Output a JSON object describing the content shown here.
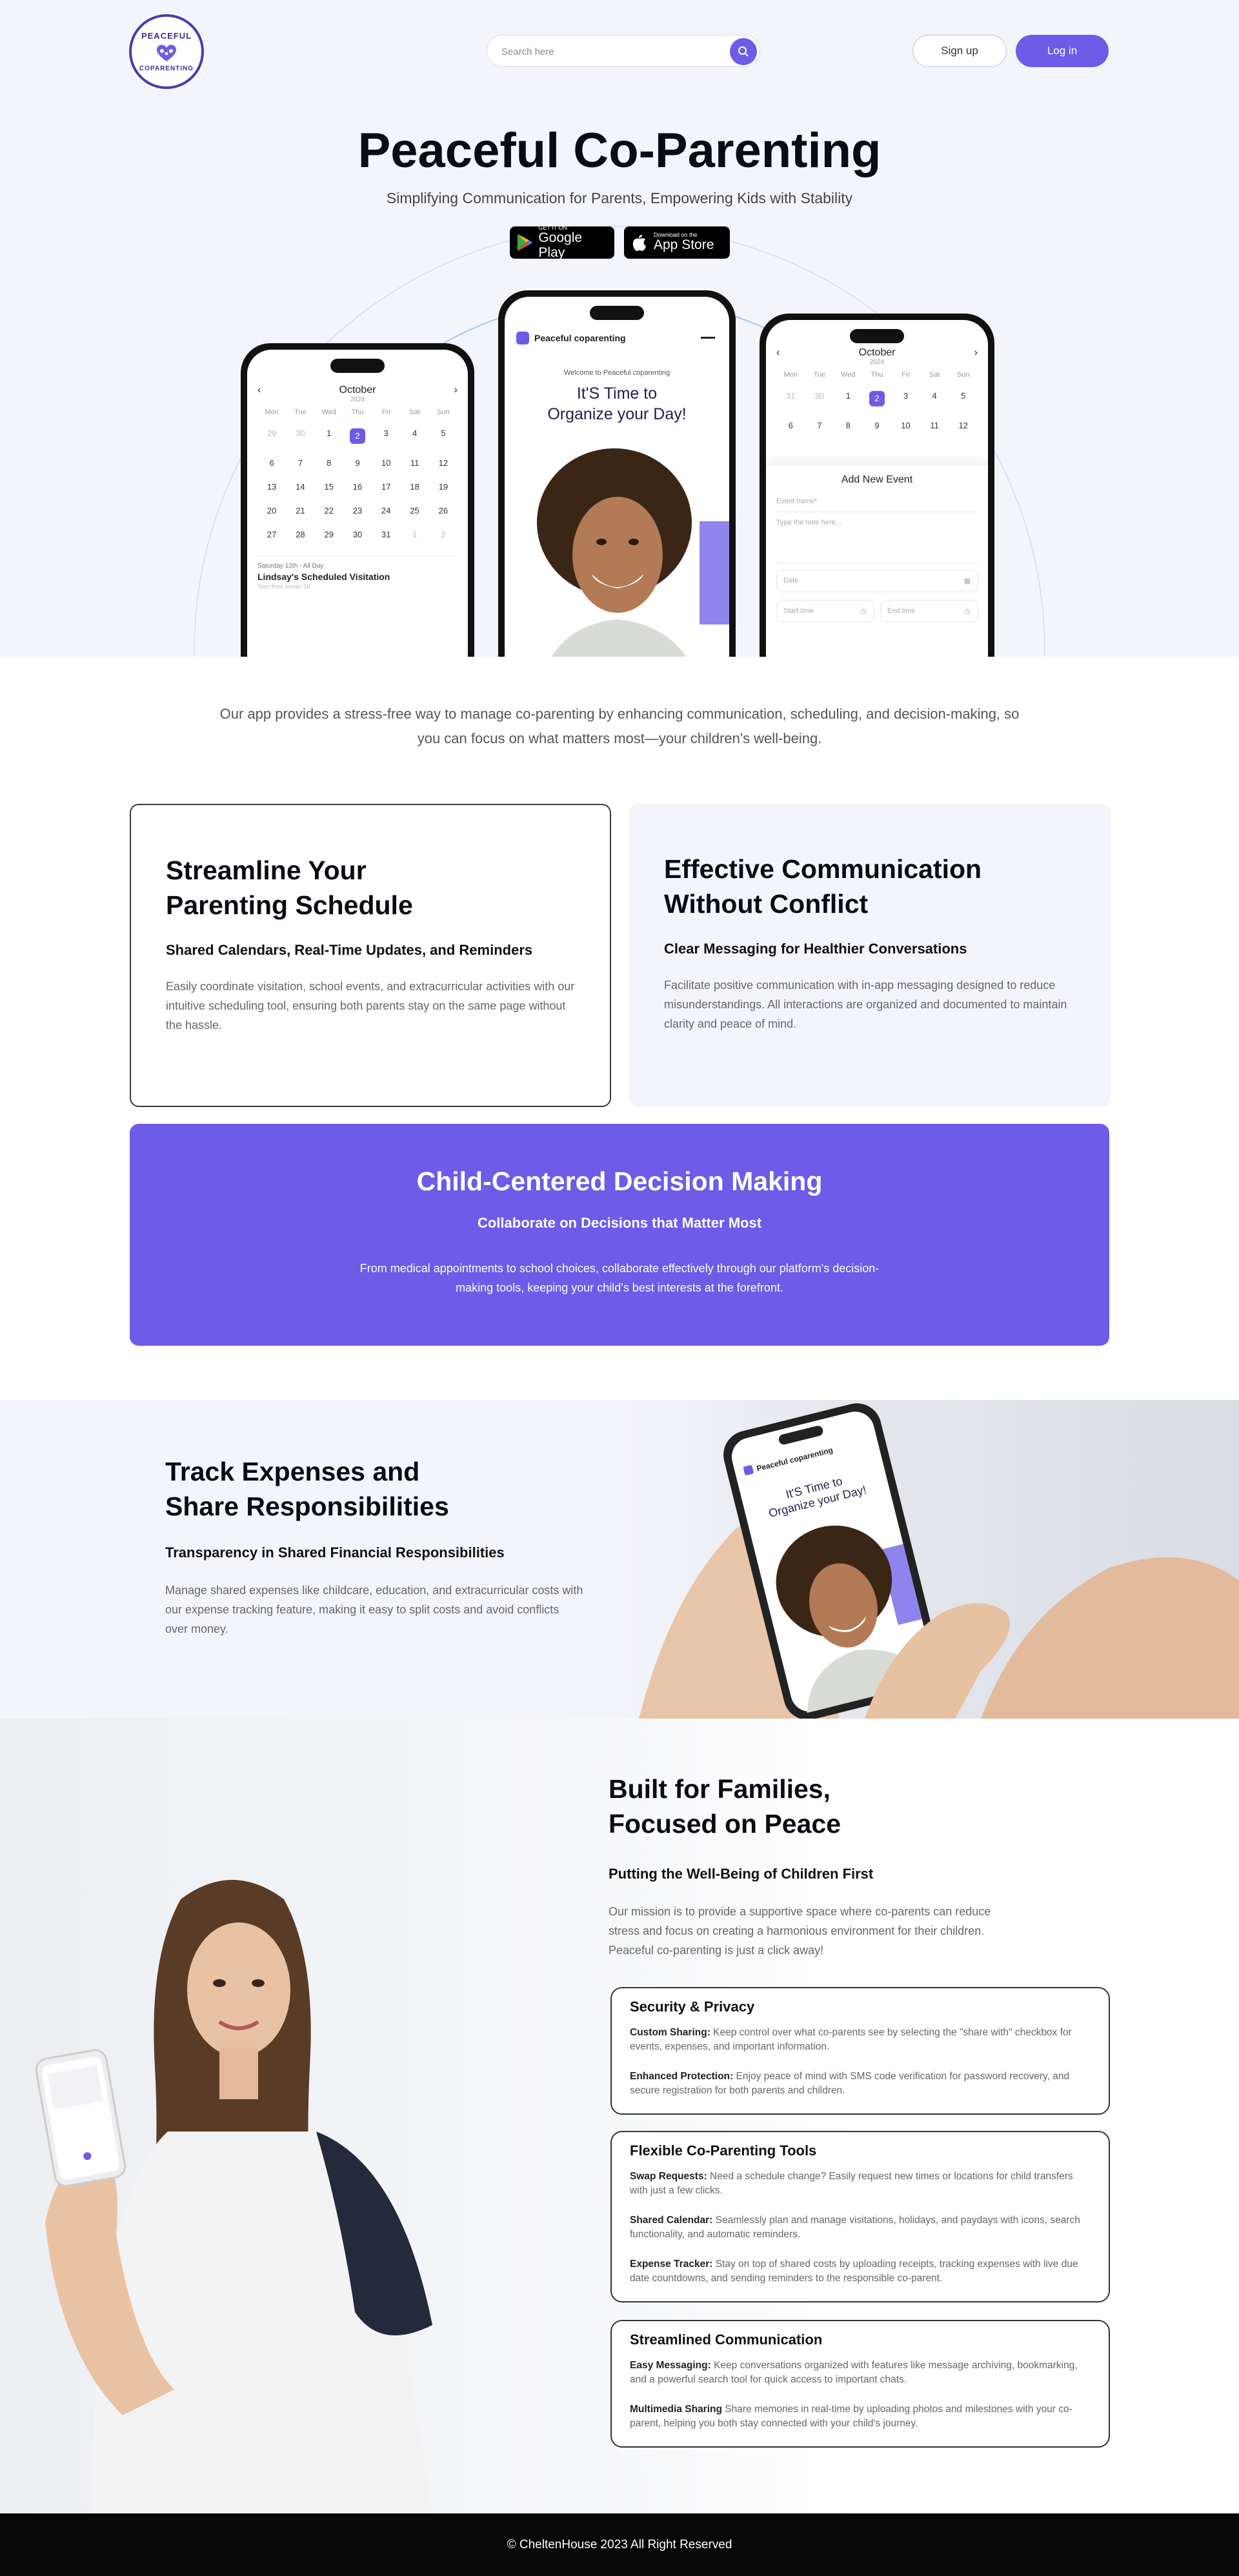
{
  "header": {
    "logo_top": "PEACEFUL",
    "logo_bottom": "COPARENTING",
    "search_placeholder": "Search here",
    "signup_label": "Sign up",
    "login_label": "Log in"
  },
  "hero": {
    "title": "Peaceful Co-Parenting",
    "subtitle": "Simplifying Communication for Parents, Empowering Kids with Stability",
    "google_small": "GET IT ON",
    "google_big": "Google Play",
    "apple_small": "Download on the",
    "apple_big": "App Store"
  },
  "phone_left": {
    "month": "October",
    "year": "2024",
    "dows": [
      "Mon",
      "Tue",
      "Wed",
      "Thu",
      "Fri",
      "Sat",
      "Sun"
    ],
    "rows": [
      [
        "29",
        "30",
        "1",
        "2",
        "3",
        "4",
        "5"
      ],
      [
        "6",
        "7",
        "8",
        "9",
        "10",
        "11",
        "12"
      ],
      [
        "13",
        "14",
        "15",
        "16",
        "17",
        "18",
        "19"
      ],
      [
        "20",
        "21",
        "22",
        "23",
        "24",
        "25",
        "26"
      ],
      [
        "27",
        "28",
        "29",
        "30",
        "31",
        "1",
        "2"
      ]
    ],
    "event_date": "Saturday 12th - All Day",
    "event_title": "Lindsay's Scheduled Visitation",
    "event_note": "Start from screen 1b"
  },
  "phone_center": {
    "brand": "Peaceful coparenting",
    "welcome": "Welcome to Peaceful coparenting",
    "headline_1": "It'S Time to",
    "headline_2": "Organize your Day!"
  },
  "phone_right": {
    "month": "October",
    "year": "2024",
    "dows": [
      "Mon",
      "Tue",
      "Wed",
      "Thu",
      "Fri",
      "Sat",
      "Sun"
    ],
    "rows": [
      [
        "31",
        "30",
        "1",
        "2",
        "3",
        "4",
        "5"
      ],
      [
        "6",
        "7",
        "8",
        "9",
        "10",
        "11",
        "12"
      ]
    ],
    "sheet_title": "Add New Event",
    "event_name": "Event name*",
    "note": "Type the note here...",
    "date": "Date",
    "start": "Start time",
    "end": "End time"
  },
  "intro": "Our app provides a stress-free way to manage co-parenting by enhancing communication, scheduling, and decision-making, so you can focus on what matters most—your children's well-being.",
  "card_schedule": {
    "title_1": "Streamline Your",
    "title_2": "Parenting Schedule",
    "subtitle": "Shared Calendars, Real-Time Updates, and Reminders",
    "body": "Easily coordinate visitation, school events, and extracurricular activities with our intuitive  scheduling tool, ensuring both parents stay on the same page without the hassle."
  },
  "card_comm": {
    "title_1": "Effective Communication",
    "title_2": "Without Conflict",
    "subtitle": "Clear Messaging for Healthier Conversations",
    "body": "Facilitate positive communication with in-app messaging designed to reduce misunderstandings. All interactions are organized and documented to maintain clarity and peace of mind."
  },
  "card_child": {
    "title": "Child-Centered Decision Making",
    "subtitle": "Collaborate on Decisions that Matter Most",
    "body": "From medical appointments to school choices, collaborate effectively through our platform's decision-making tools, keeping your child's best interests at the forefront."
  },
  "expenses": {
    "title_1": "Track Expenses and",
    "title_2": "Share Responsibilities",
    "subtitle": "Transparency in Shared Financial Responsibilities",
    "body": "Manage shared expenses like childcare, education, and extracurricular costs with our expense tracking feature, making it easy to split costs and avoid conflicts over money."
  },
  "families": {
    "title_1": "Built for Families,",
    "title_2": "Focused on Peace",
    "subtitle": "Putting the Well-Being of Children First",
    "body": "Our mission is to provide a supportive space where co-parents can reduce stress and focus on creating a harmonious environment for their children. Peaceful co-parenting is just a click away!"
  },
  "features": [
    {
      "title": "Security & Privacy",
      "items": [
        {
          "label": "Custom Sharing:",
          "text": " Keep control over what co-parents see by selecting the \"share with\" checkbox for events, expenses, and important information."
        },
        {
          "label": "Enhanced Protection:",
          "text": " Enjoy peace of mind with SMS code verification for password recovery, and secure registration for both parents and children."
        }
      ]
    },
    {
      "title": "Flexible Co-Parenting Tools",
      "items": [
        {
          "label": "Swap Requests:",
          "text": " Need a schedule change? Easily request new times or locations for child transfers with just a few clicks."
        },
        {
          "label": "Shared Calendar:",
          "text": " Seamlessly plan and manage visitations, holidays, and paydays with icons, search functionality, and automatic reminders."
        },
        {
          "label": "Expense Tracker:",
          "text": " Stay on top of shared costs by uploading receipts, tracking expenses with live due date countdowns, and sending reminders to the responsible co-parent."
        }
      ]
    },
    {
      "title": "Streamlined Communication",
      "items": [
        {
          "label": "Easy Messaging:",
          "text": "  Keep conversations organized with features like message archiving, bookmarking, and a powerful search tool for quick access to important chats."
        },
        {
          "label": "Multimedia Sharing",
          "text": " Share memories in real-time by uploading photos and milestones with your co-parent, helping you both stay connected with your child's journey."
        }
      ]
    }
  ],
  "footer": "© CheltenHouse 2023 All Right Reserved",
  "colors": {
    "accent": "#6c5ce7",
    "dark": "#0b0b14",
    "footer_bg": "#070708"
  }
}
